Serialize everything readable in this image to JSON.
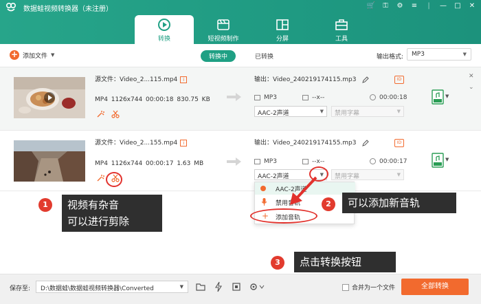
{
  "window": {
    "title": "数据蛙视频转换器（未注册）",
    "controls": [
      "cart-icon",
      "key-icon",
      "gear-icon",
      "menu-icon",
      "minimize-icon",
      "maximize-icon",
      "close-icon"
    ]
  },
  "main_tabs": [
    {
      "label": "转换",
      "icon": "convert-icon",
      "active": true
    },
    {
      "label": "短视频制作",
      "icon": "short-video-icon",
      "active": false
    },
    {
      "label": "分屏",
      "icon": "split-screen-icon",
      "active": false
    },
    {
      "label": "工具",
      "icon": "toolbox-icon",
      "active": false
    }
  ],
  "toolbar": {
    "add_file": "添加文件",
    "status_tabs": [
      "转换中",
      "已转换"
    ],
    "output_format_label": "输出格式:",
    "output_format_value": "MP3"
  },
  "files": [
    {
      "source_name": "源文件：Video_2...115.mp4",
      "meta": "MP4   1126x744   00:00:18   830.75 KB",
      "output_name": "输出：Video_240219174115.mp3",
      "out_format": "MP3",
      "out_res": "--x--",
      "out_duration": "00:00:18",
      "audio_track": "AAC-2声道",
      "subtitle": "禁用字幕"
    },
    {
      "source_name": "源文件：Video_2...155.mp4",
      "meta": "MP4   1126x744   00:00:17   1.63 MB",
      "output_name": "输出：Video_240219174155.mp3",
      "out_format": "MP3",
      "out_res": "--x--",
      "out_duration": "00:00:17",
      "audio_track": "AAC-2声道",
      "subtitle": "禁用字幕"
    }
  ],
  "audio_dropdown": {
    "items": [
      "AAC-2声道",
      "禁用音轨",
      "添加音轨"
    ]
  },
  "callouts": [
    {
      "num": "1",
      "line1": "视频有杂音",
      "line2": "可以进行剪除"
    },
    {
      "num": "2",
      "text": "可以添加新音轨"
    },
    {
      "num": "3",
      "text": "点击转换按钮"
    }
  ],
  "footer": {
    "save_label": "保存至:",
    "save_path": "D:\\数据蛙\\数据蛙视频转换器\\Converted",
    "merge_label": "合并为一个文件",
    "convert_all": "全部转换"
  },
  "colors": {
    "header": "#22a086",
    "accent": "#f26a2e",
    "callout_bg": "#2f2f2f",
    "highlight": "#e2312c"
  }
}
